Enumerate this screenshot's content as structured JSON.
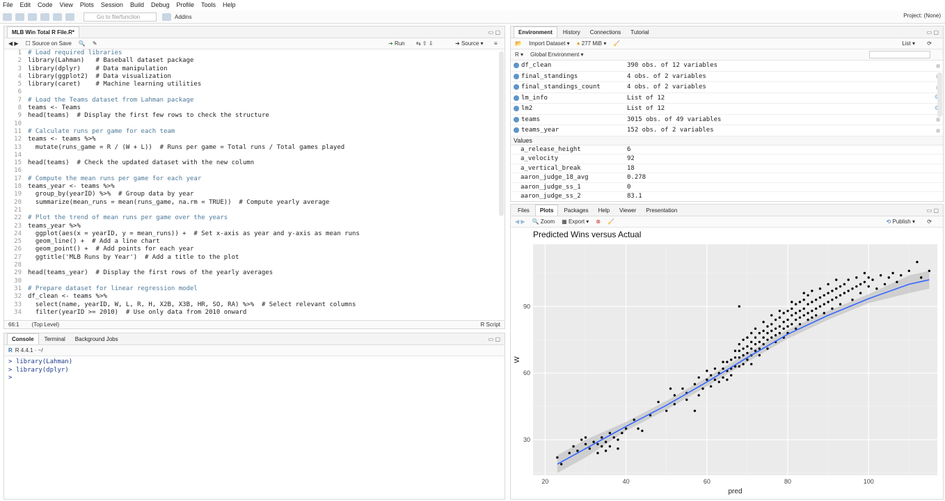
{
  "menu": [
    "File",
    "Edit",
    "Code",
    "View",
    "Plots",
    "Session",
    "Build",
    "Debug",
    "Profile",
    "Tools",
    "Help"
  ],
  "toolbar": {
    "goto_placeholder": "Go to file/function",
    "addins": "Addins",
    "project": "Project: (None)"
  },
  "editor": {
    "tab": "MLB Win Total R File.R*",
    "source_on_save": "Source on Save",
    "run": "Run",
    "source": "Source",
    "cursor": "66:1",
    "scope": "(Top Level)",
    "filetype": "R Script",
    "lines": [
      {
        "n": "1",
        "t": "# Load required libraries",
        "c": "cmt"
      },
      {
        "n": "2",
        "t": "library(Lahman)   # Baseball dataset package",
        "c": ""
      },
      {
        "n": "3",
        "t": "library(dplyr)    # Data manipulation",
        "c": ""
      },
      {
        "n": "4",
        "t": "library(ggplot2)  # Data visualization",
        "c": ""
      },
      {
        "n": "5",
        "t": "library(caret)    # Machine learning utilities",
        "c": ""
      },
      {
        "n": "6",
        "t": "",
        "c": ""
      },
      {
        "n": "7",
        "t": "# Load the Teams dataset from Lahman package",
        "c": "cmt"
      },
      {
        "n": "8",
        "t": "teams <- Teams",
        "c": ""
      },
      {
        "n": "9",
        "t": "head(teams)  # Display the first few rows to check the structure",
        "c": ""
      },
      {
        "n": "10",
        "t": "",
        "c": ""
      },
      {
        "n": "11",
        "t": "# Calculate runs per game for each team",
        "c": "cmt"
      },
      {
        "n": "12",
        "t": "teams <- teams %>%",
        "c": ""
      },
      {
        "n": "13",
        "t": "  mutate(runs_game = R / (W + L))  # Runs per game = Total runs / Total games played",
        "c": ""
      },
      {
        "n": "14",
        "t": "",
        "c": ""
      },
      {
        "n": "15",
        "t": "head(teams)  # Check the updated dataset with the new column",
        "c": ""
      },
      {
        "n": "16",
        "t": "",
        "c": ""
      },
      {
        "n": "17",
        "t": "# Compute the mean runs per game for each year",
        "c": "cmt"
      },
      {
        "n": "18",
        "t": "teams_year <- teams %>%",
        "c": ""
      },
      {
        "n": "19",
        "t": "  group_by(yearID) %>%  # Group data by year",
        "c": ""
      },
      {
        "n": "20",
        "t": "  summarize(mean_runs = mean(runs_game, na.rm = TRUE))  # Compute yearly average",
        "c": ""
      },
      {
        "n": "21",
        "t": "",
        "c": ""
      },
      {
        "n": "22",
        "t": "# Plot the trend of mean runs per game over the years",
        "c": "cmt"
      },
      {
        "n": "23",
        "t": "teams_year %>%",
        "c": ""
      },
      {
        "n": "24",
        "t": "  ggplot(aes(x = yearID, y = mean_runs)) +  # Set x-axis as year and y-axis as mean runs",
        "c": ""
      },
      {
        "n": "25",
        "t": "  geom_line() +  # Add a line chart",
        "c": ""
      },
      {
        "n": "26",
        "t": "  geom_point() +  # Add points for each year",
        "c": ""
      },
      {
        "n": "27",
        "t": "  ggtitle('MLB Runs by Year')  # Add a title to the plot",
        "c": ""
      },
      {
        "n": "28",
        "t": "",
        "c": ""
      },
      {
        "n": "29",
        "t": "head(teams_year)  # Display the first rows of the yearly averages",
        "c": ""
      },
      {
        "n": "30",
        "t": "",
        "c": ""
      },
      {
        "n": "31",
        "t": "# Prepare dataset for linear regression model",
        "c": "cmt"
      },
      {
        "n": "32",
        "t": "df_clean <- teams %>%",
        "c": ""
      },
      {
        "n": "33",
        "t": "  select(name, yearID, W, L, R, H, X2B, X3B, HR, SO, RA) %>%  # Select relevant columns",
        "c": ""
      },
      {
        "n": "34",
        "t": "  filter(yearID >= 2010)  # Use only data from 2010 onward",
        "c": ""
      }
    ]
  },
  "console": {
    "tabs": [
      "Console",
      "Terminal",
      "Background Jobs"
    ],
    "version": "R 4.4.1 · ~/",
    "lines": [
      "> library(Lahman)",
      "> library(dplyr)",
      "> "
    ]
  },
  "environment": {
    "tabs": [
      "Environment",
      "History",
      "Connections",
      "Tutorial"
    ],
    "import": "Import Dataset",
    "memory": "277 MiB",
    "list": "List",
    "lang": "R",
    "scope": "Global Environment",
    "data": [
      {
        "name": "df_clean",
        "value": "390 obs. of 12 variables"
      },
      {
        "name": "final_standings",
        "value": "4 obs. of 2 variables"
      },
      {
        "name": "final_standings_count",
        "value": "4 obs. of 2 variables"
      },
      {
        "name": "lm_info",
        "value": "List of  12"
      },
      {
        "name": "lm2",
        "value": "List of  12"
      },
      {
        "name": "teams",
        "value": "3015 obs. of 49 variables"
      },
      {
        "name": "teams_year",
        "value": "152 obs. of 2 variables"
      }
    ],
    "values_header": "Values",
    "values": [
      {
        "name": "a_release_height",
        "value": "6"
      },
      {
        "name": "a_velocity",
        "value": "92"
      },
      {
        "name": "a_vertical_break",
        "value": "18"
      },
      {
        "name": "aaron_judge_18_avg",
        "value": "0.278"
      },
      {
        "name": "aaron_judge_ss_1",
        "value": "0"
      },
      {
        "name": "aaron_judge_ss_2",
        "value": "83.1"
      }
    ]
  },
  "plots": {
    "tabs": [
      "Files",
      "Plots",
      "Packages",
      "Help",
      "Viewer",
      "Presentation"
    ],
    "zoom": "Zoom",
    "export": "Export",
    "publish": "Publish"
  },
  "chart_data": {
    "type": "scatter",
    "title": "Predicted Wins versus Actual",
    "xlabel": "pred",
    "ylabel": "W",
    "xlim": [
      17,
      117
    ],
    "ylim": [
      14,
      118
    ],
    "xticks": [
      20,
      40,
      60,
      80,
      100
    ],
    "yticks": [
      30,
      60,
      90
    ],
    "grid": true,
    "smooth": {
      "x": [
        23,
        30,
        40,
        50,
        60,
        70,
        80,
        90,
        100,
        110,
        115
      ],
      "y": [
        19,
        26,
        36,
        45.5,
        56,
        67,
        77.5,
        86,
        93.5,
        100,
        102
      ]
    },
    "points": [
      [
        23,
        22
      ],
      [
        24,
        19
      ],
      [
        26,
        24
      ],
      [
        27,
        27
      ],
      [
        28,
        25
      ],
      [
        29,
        30
      ],
      [
        30,
        28
      ],
      [
        30,
        31
      ],
      [
        31,
        26
      ],
      [
        32,
        29
      ],
      [
        33,
        24
      ],
      [
        33,
        28
      ],
      [
        34,
        27
      ],
      [
        34,
        31
      ],
      [
        35,
        25
      ],
      [
        35,
        29
      ],
      [
        36,
        33
      ],
      [
        36,
        27
      ],
      [
        37,
        31
      ],
      [
        38,
        26
      ],
      [
        38,
        30
      ],
      [
        39,
        33
      ],
      [
        40,
        35
      ],
      [
        42,
        39
      ],
      [
        43,
        35
      ],
      [
        44,
        34
      ],
      [
        46,
        41
      ],
      [
        48,
        47
      ],
      [
        50,
        43
      ],
      [
        51,
        53
      ],
      [
        52,
        50
      ],
      [
        52,
        46
      ],
      [
        54,
        53
      ],
      [
        55,
        48
      ],
      [
        55,
        51
      ],
      [
        57,
        55
      ],
      [
        57,
        43
      ],
      [
        58,
        50
      ],
      [
        58,
        58
      ],
      [
        59,
        53
      ],
      [
        60,
        57
      ],
      [
        60,
        61
      ],
      [
        61,
        54
      ],
      [
        61,
        59
      ],
      [
        62,
        57
      ],
      [
        62,
        62
      ],
      [
        63,
        60
      ],
      [
        63,
        56
      ],
      [
        64,
        62
      ],
      [
        64,
        58
      ],
      [
        64,
        65
      ],
      [
        65,
        61
      ],
      [
        65,
        57
      ],
      [
        65,
        65
      ],
      [
        66,
        66
      ],
      [
        66,
        59
      ],
      [
        66,
        62
      ],
      [
        67,
        63
      ],
      [
        67,
        67
      ],
      [
        67,
        70
      ],
      [
        68,
        63
      ],
      [
        68,
        67
      ],
      [
        68,
        70
      ],
      [
        68,
        73
      ],
      [
        68,
        90
      ],
      [
        69,
        64
      ],
      [
        69,
        68
      ],
      [
        69,
        71
      ],
      [
        69,
        75
      ],
      [
        70,
        66
      ],
      [
        70,
        69
      ],
      [
        70,
        72
      ],
      [
        70,
        76
      ],
      [
        71,
        68
      ],
      [
        71,
        71
      ],
      [
        71,
        74
      ],
      [
        71,
        78
      ],
      [
        71,
        64
      ],
      [
        72,
        70
      ],
      [
        72,
        73
      ],
      [
        72,
        76
      ],
      [
        72,
        80
      ],
      [
        73,
        71
      ],
      [
        73,
        74
      ],
      [
        73,
        78
      ],
      [
        73,
        68
      ],
      [
        74,
        73
      ],
      [
        74,
        76
      ],
      [
        74,
        79
      ],
      [
        74,
        83
      ],
      [
        75,
        75
      ],
      [
        75,
        78
      ],
      [
        75,
        81
      ],
      [
        75,
        71
      ],
      [
        76,
        76
      ],
      [
        76,
        79
      ],
      [
        76,
        82
      ],
      [
        76,
        86
      ],
      [
        77,
        77
      ],
      [
        77,
        80
      ],
      [
        77,
        84
      ],
      [
        77,
        74
      ],
      [
        78,
        78
      ],
      [
        78,
        81
      ],
      [
        78,
        85
      ],
      [
        78,
        88
      ],
      [
        79,
        80
      ],
      [
        79,
        83
      ],
      [
        79,
        76
      ],
      [
        79,
        87
      ],
      [
        80,
        81
      ],
      [
        80,
        84
      ],
      [
        80,
        88
      ],
      [
        80,
        78
      ],
      [
        81,
        82
      ],
      [
        81,
        86
      ],
      [
        81,
        89
      ],
      [
        81,
        92
      ],
      [
        82,
        84
      ],
      [
        82,
        87
      ],
      [
        82,
        80
      ],
      [
        82,
        91
      ],
      [
        83,
        85
      ],
      [
        83,
        88
      ],
      [
        83,
        92
      ],
      [
        83,
        82
      ],
      [
        84,
        86
      ],
      [
        84,
        89
      ],
      [
        84,
        93
      ],
      [
        84,
        96
      ],
      [
        85,
        87
      ],
      [
        85,
        91
      ],
      [
        85,
        84
      ],
      [
        85,
        95
      ],
      [
        86,
        88
      ],
      [
        86,
        92
      ],
      [
        86,
        85
      ],
      [
        86,
        97
      ],
      [
        87,
        89
      ],
      [
        87,
        93
      ],
      [
        87,
        86
      ],
      [
        88,
        90
      ],
      [
        88,
        94
      ],
      [
        88,
        98
      ],
      [
        89,
        91
      ],
      [
        89,
        95
      ],
      [
        89,
        87
      ],
      [
        90,
        92
      ],
      [
        90,
        96
      ],
      [
        90,
        100
      ],
      [
        91,
        93
      ],
      [
        91,
        97
      ],
      [
        91,
        89
      ],
      [
        92,
        94
      ],
      [
        92,
        98
      ],
      [
        92,
        102
      ],
      [
        93,
        95
      ],
      [
        93,
        99
      ],
      [
        93,
        91
      ],
      [
        94,
        96
      ],
      [
        94,
        100
      ],
      [
        95,
        97
      ],
      [
        95,
        102
      ],
      [
        96,
        98
      ],
      [
        96,
        93
      ],
      [
        97,
        99
      ],
      [
        97,
        103
      ],
      [
        98,
        100
      ],
      [
        98,
        96
      ],
      [
        99,
        101
      ],
      [
        99,
        105
      ],
      [
        100,
        99
      ],
      [
        100,
        103
      ],
      [
        101,
        102
      ],
      [
        102,
        98
      ],
      [
        103,
        104
      ],
      [
        104,
        100
      ],
      [
        105,
        103
      ],
      [
        106,
        105
      ],
      [
        107,
        101
      ],
      [
        108,
        104
      ],
      [
        110,
        106
      ],
      [
        112,
        110
      ],
      [
        113,
        103
      ],
      [
        115,
        106
      ]
    ]
  }
}
